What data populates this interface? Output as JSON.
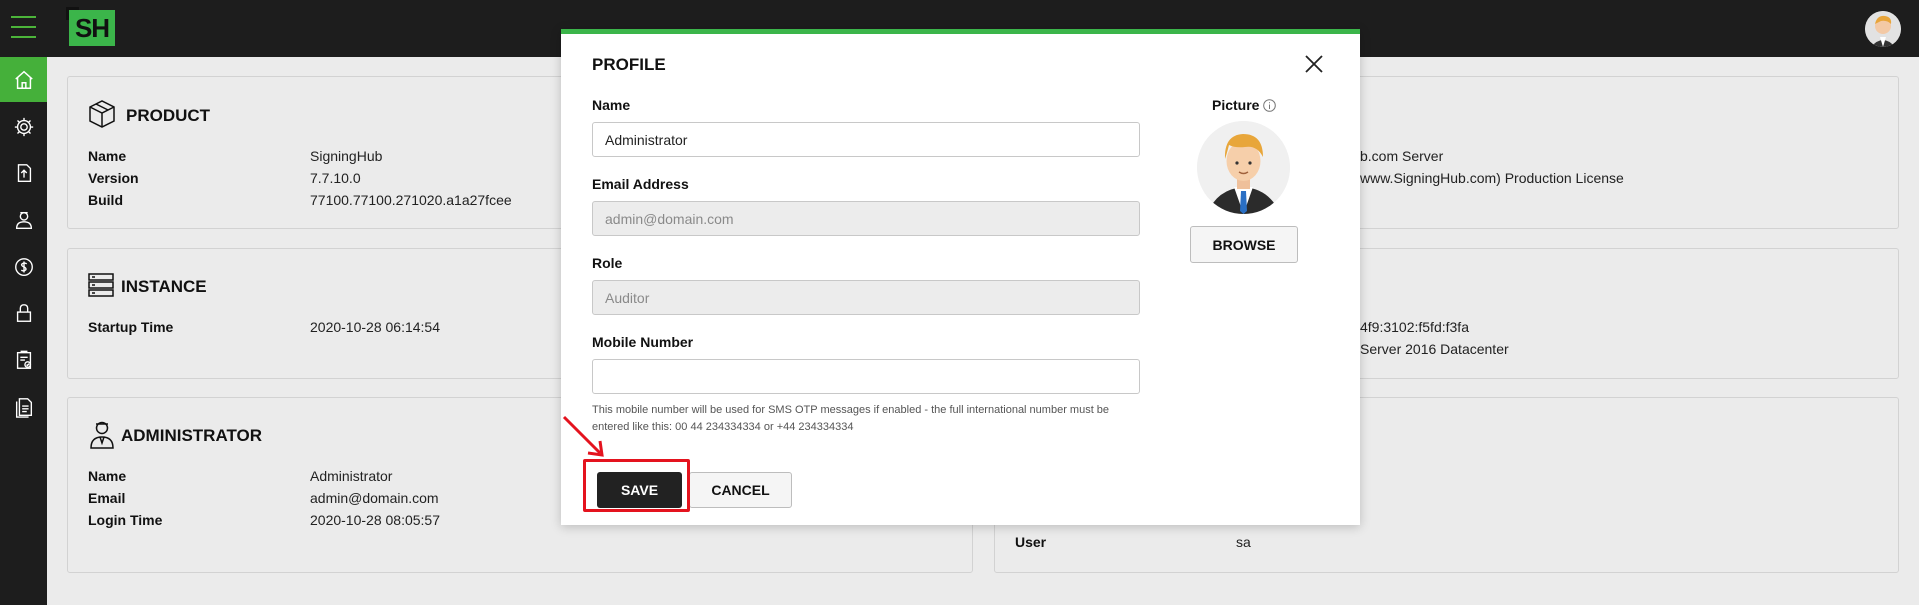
{
  "topbar": {
    "logo": "SH"
  },
  "sidebar": {
    "items": [
      {
        "icon": "home-icon",
        "active": true
      },
      {
        "icon": "gear-icon"
      },
      {
        "icon": "upload-icon"
      },
      {
        "icon": "user-icon"
      },
      {
        "icon": "dollar-icon"
      },
      {
        "icon": "lock-icon"
      },
      {
        "icon": "clipboard-check-icon"
      },
      {
        "icon": "document-icon"
      }
    ]
  },
  "panels": {
    "product": {
      "title": "PRODUCT",
      "rows": [
        {
          "label": "Name",
          "value": "SigningHub"
        },
        {
          "label": "Version",
          "value": "7.7.10.0"
        },
        {
          "label": "Build",
          "value": "77100.77100.271020.a1a27fcee"
        }
      ],
      "right_fragments": [
        "b.com Server",
        "www.SigningHub.com) Production License"
      ]
    },
    "instance": {
      "title": "INSTANCE",
      "rows": [
        {
          "label": "Startup Time",
          "value": "2020-10-28 06:14:54"
        }
      ],
      "right_fragments": [
        "4f9:3102:f5fd:f3fa",
        "Server 2016 Datacenter"
      ]
    },
    "administrator": {
      "title": "ADMINISTRATOR",
      "rows": [
        {
          "label": "Name",
          "value": "Administrator"
        },
        {
          "label": "Email",
          "value": "admin@domain.com"
        },
        {
          "label": "Login Time",
          "value": "2020-10-28 08:05:57"
        }
      ],
      "right_rows": [
        {
          "label": "User",
          "value": "sa"
        }
      ]
    }
  },
  "modal": {
    "title": "PROFILE",
    "name_label": "Name",
    "name_value": "Administrator",
    "email_label": "Email Address",
    "email_value": "admin@domain.com",
    "role_label": "Role",
    "role_value": "Auditor",
    "mobile_label": "Mobile Number",
    "mobile_value": "",
    "help_text": "This mobile number will be used for SMS OTP messages if enabled - the full international number must be entered like this: 00 44 234334334 or +44 234334334",
    "picture_label": "Picture",
    "browse_label": "BROWSE",
    "save_label": "SAVE",
    "cancel_label": "CANCEL"
  },
  "colors": {
    "accent": "#3bb54a",
    "dark": "#1d1d1d",
    "annotation": "#e4131e"
  }
}
